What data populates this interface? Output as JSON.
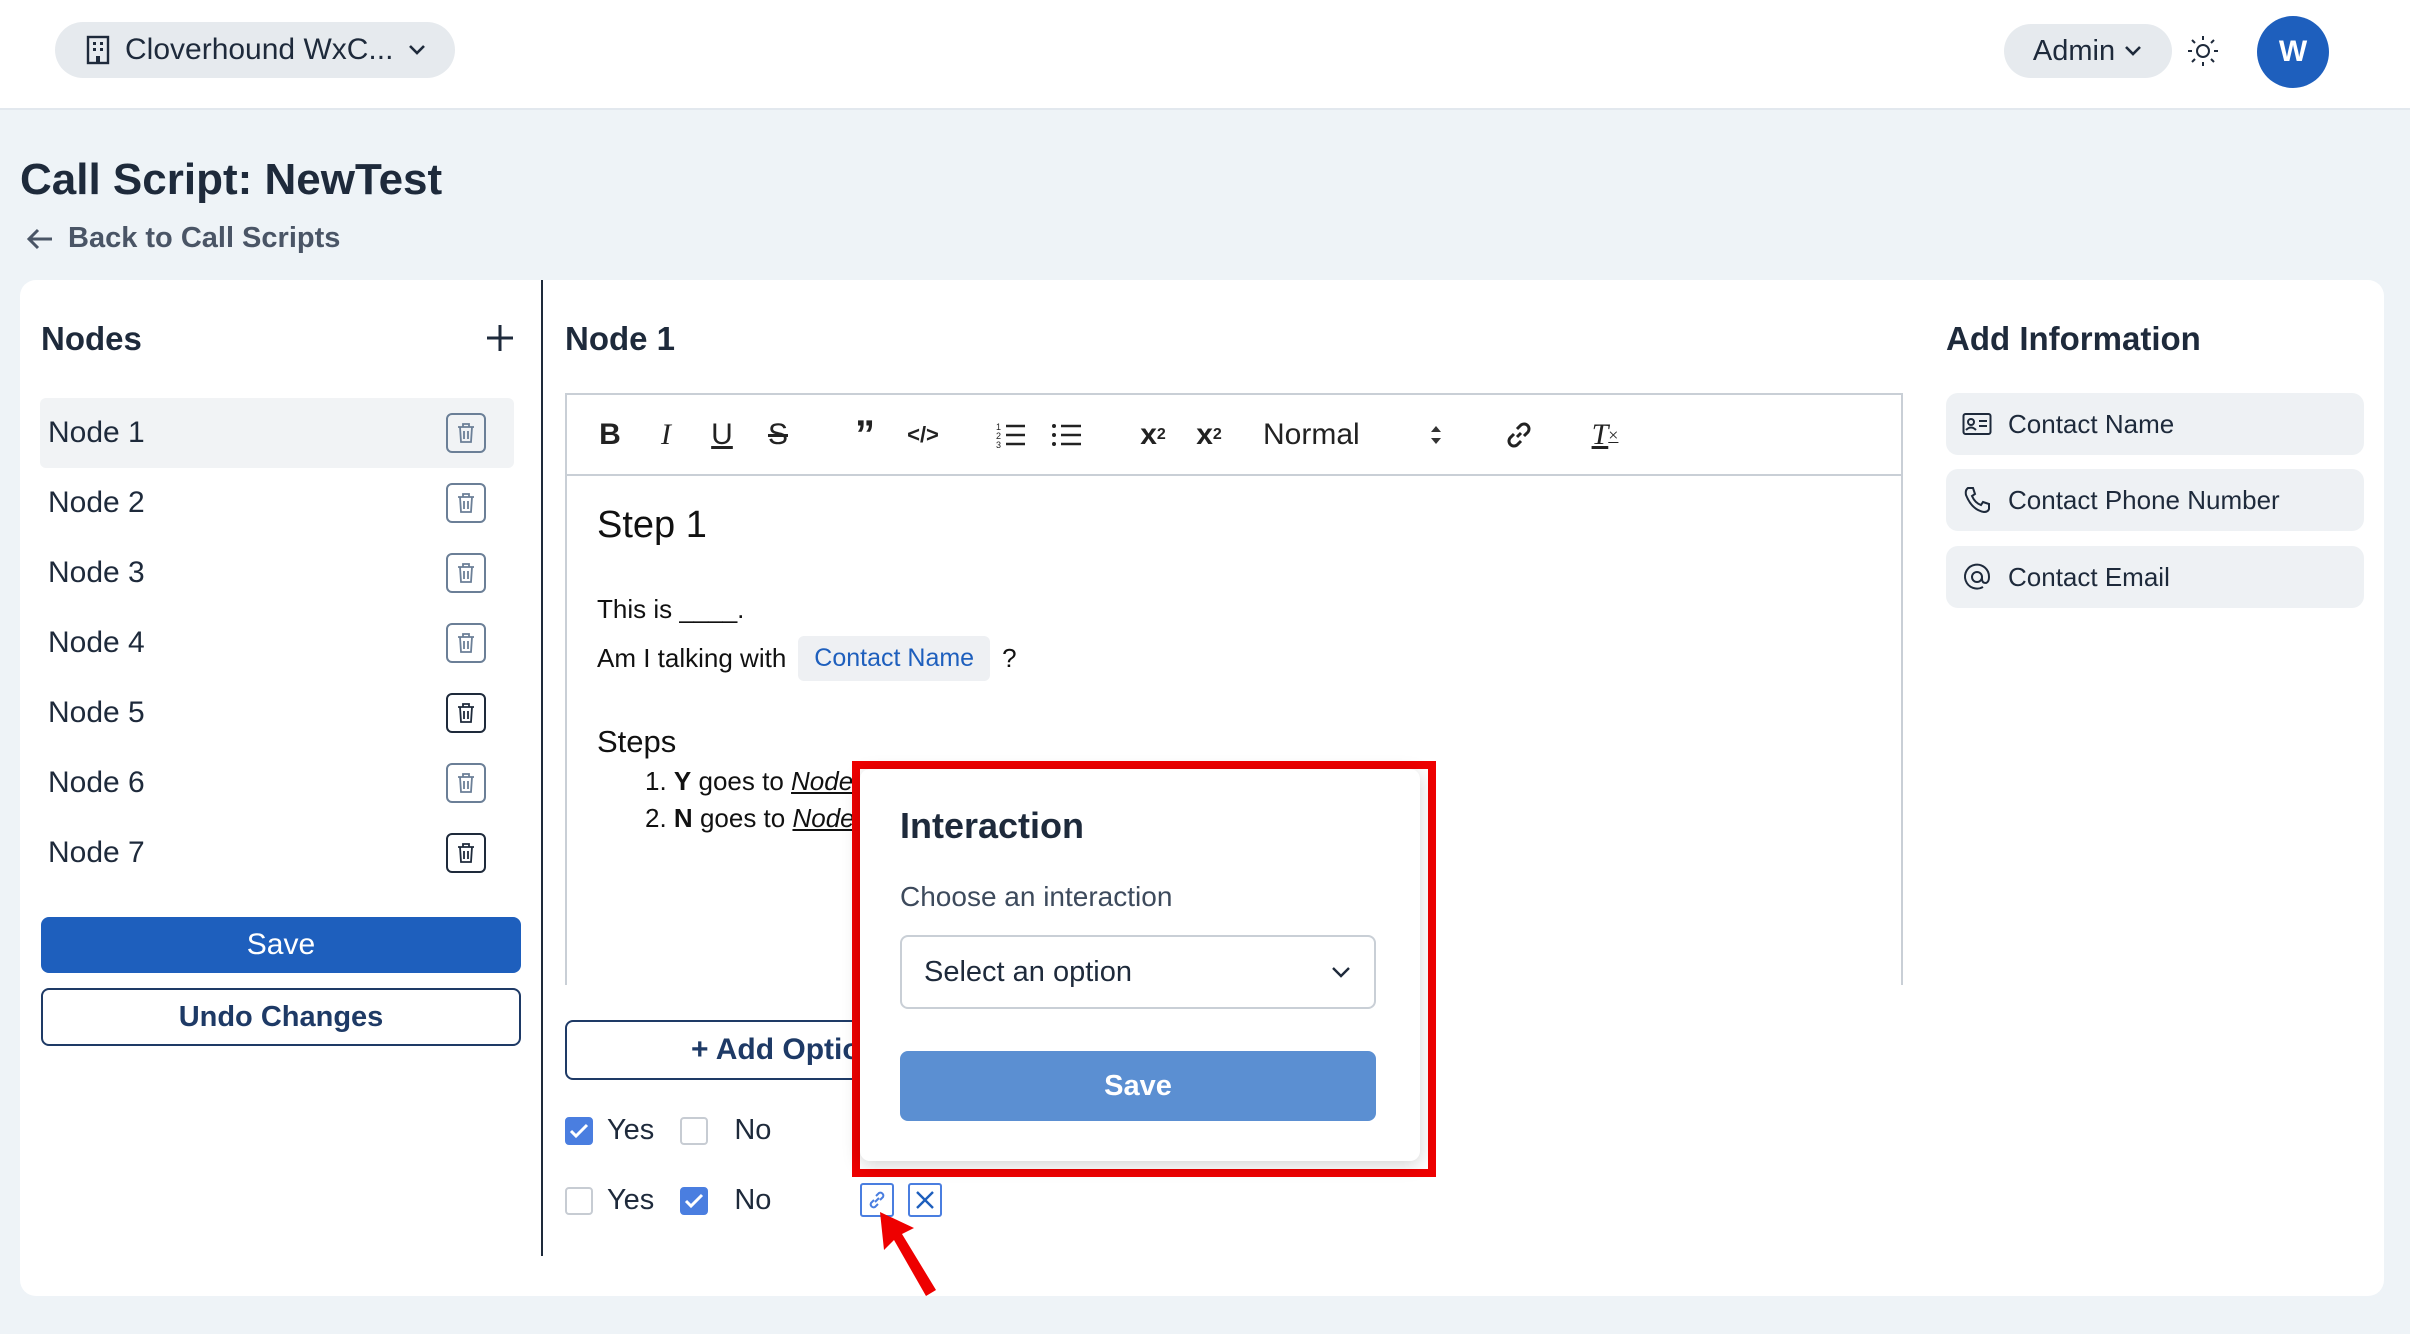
{
  "header": {
    "org_name": "Cloverhound WxC...",
    "role": "Admin",
    "avatar_initial": "W"
  },
  "page": {
    "title": "Call Script: NewTest",
    "back_link": "Back to Call Scripts"
  },
  "nodes_panel": {
    "title": "Nodes",
    "items": [
      {
        "label": "Node 1"
      },
      {
        "label": "Node 2"
      },
      {
        "label": "Node 3"
      },
      {
        "label": "Node 4"
      },
      {
        "label": "Node 5"
      },
      {
        "label": "Node 6"
      },
      {
        "label": "Node 7"
      }
    ],
    "save_label": "Save",
    "undo_label": "Undo Changes"
  },
  "editor": {
    "title": "Node 1",
    "toolbar": {
      "heading_select": "Normal"
    },
    "content": {
      "heading": "Step 1",
      "line1": "This is ____.",
      "line2_prefix": "Am I talking with",
      "contact_chip": "Contact Name",
      "line2_suffix": "?",
      "steps_heading": "Steps",
      "step1_num": "1.",
      "step1_key": "Y",
      "step1_mid": "goes to",
      "step1_link": "Node",
      "step2_num": "2.",
      "step2_key": "N",
      "step2_mid": "goes to",
      "step2_link": "Node"
    }
  },
  "options": {
    "add_label": "+ Add Option",
    "rows": [
      {
        "yes_label": "Yes",
        "no_label": "No",
        "yes_checked": true,
        "no_checked": false
      },
      {
        "yes_label": "Yes",
        "no_label": "No",
        "yes_checked": false,
        "no_checked": true
      }
    ]
  },
  "add_information": {
    "title": "Add Information",
    "items": [
      {
        "label": "Contact Name",
        "icon": "contact-card-icon"
      },
      {
        "label": "Contact Phone Number",
        "icon": "phone-icon"
      },
      {
        "label": "Contact Email",
        "icon": "at-icon"
      }
    ]
  },
  "interaction_popover": {
    "title": "Interaction",
    "label": "Choose an interaction",
    "select_value": "Select an option",
    "save_label": "Save"
  },
  "colors": {
    "primary": "#1e5fbd",
    "highlight": "#ee0000",
    "checkbox": "#4a7ee0"
  }
}
